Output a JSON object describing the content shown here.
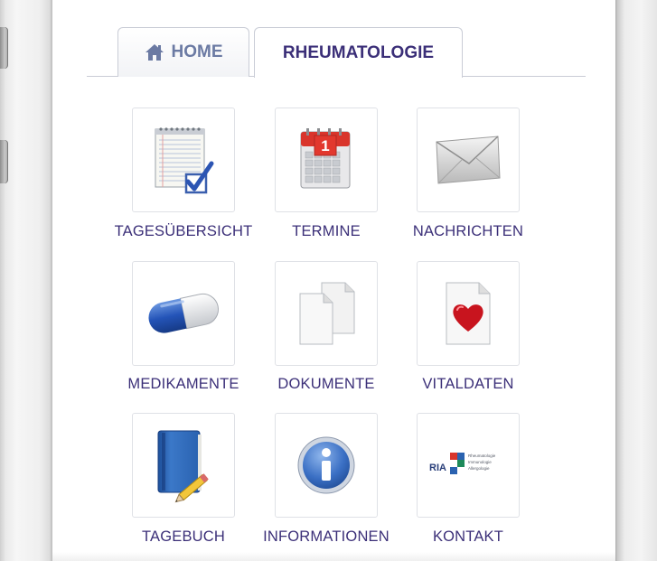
{
  "tabs": {
    "home_label": "HOME",
    "active_label": "RHEUMATOLOGIE"
  },
  "grid": {
    "items": [
      {
        "label": "TAGESÜBERSICHT",
        "icon": "checklist-icon"
      },
      {
        "label": "TERMINE",
        "icon": "calendar-icon"
      },
      {
        "label": "NACHRICHTEN",
        "icon": "envelope-icon"
      },
      {
        "label": "MEDIKAMENTE",
        "icon": "capsule-icon"
      },
      {
        "label": "DOKUMENTE",
        "icon": "documents-icon"
      },
      {
        "label": "VITALDATEN",
        "icon": "heart-document-icon"
      },
      {
        "label": "TAGEBUCH",
        "icon": "diary-pen-icon"
      },
      {
        "label": "INFORMATIONEN",
        "icon": "info-icon"
      },
      {
        "label": "KONTAKT",
        "icon": "ria-logo-icon"
      }
    ]
  },
  "calendar_day": "1",
  "logo": {
    "text": "RIA",
    "lines": [
      "Rheumatologie",
      "Immunologie",
      "Allergologie"
    ]
  },
  "colors": {
    "label": "#3b2f78",
    "home_tab_text": "#6b7aa3",
    "tile_border": "#dfe1e6",
    "tab_border": "#c9ccd6"
  }
}
